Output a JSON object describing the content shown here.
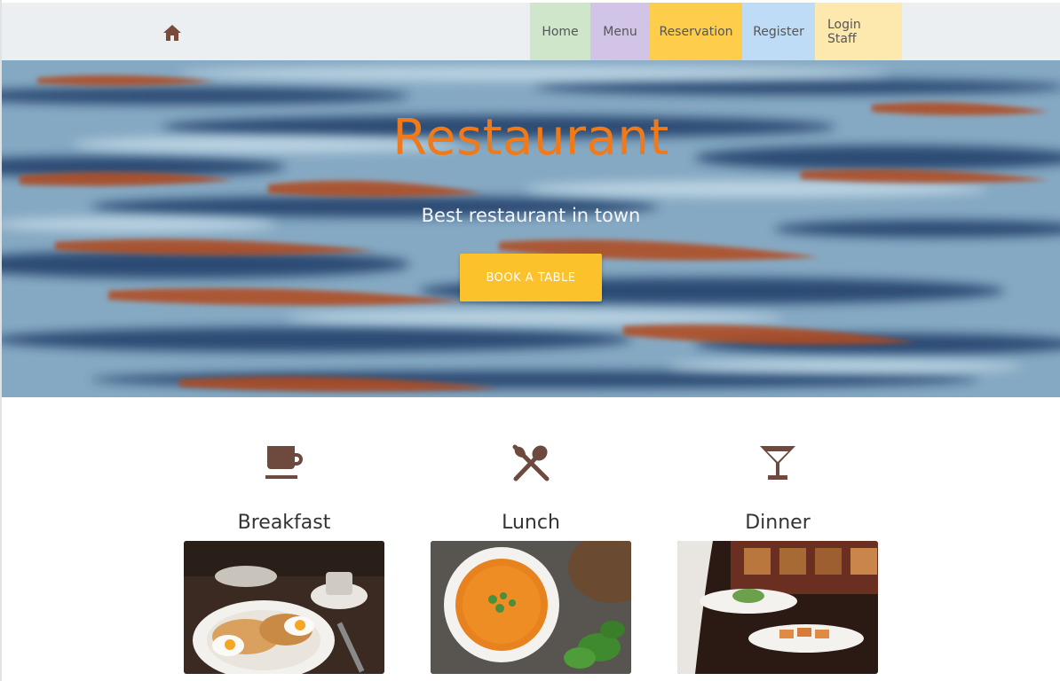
{
  "nav": {
    "home_icon": "home-icon",
    "items": [
      {
        "label": "Home",
        "color": "#cfe6cb"
      },
      {
        "label": "Menu",
        "color": "#d2c4e6"
      },
      {
        "label": "Reservation",
        "color": "#fdcd4b"
      },
      {
        "label": "Register",
        "color": "#bfdcf7"
      },
      {
        "label": "Login Staff",
        "color": "#fde9ae"
      }
    ]
  },
  "hero": {
    "title": "Restaurant",
    "subtitle": "Best restaurant in town",
    "button_label": "BOOK A TABLE",
    "title_color": "#f07a1a",
    "button_color": "#fcc22c"
  },
  "features": [
    {
      "label": "Breakfast",
      "icon": "coffee-cup-icon"
    },
    {
      "label": "Lunch",
      "icon": "utensils-icon"
    },
    {
      "label": "Dinner",
      "icon": "cocktail-glass-icon"
    }
  ],
  "colors": {
    "icon": "#6e4a3e",
    "navbar_bg": "#eceff2"
  }
}
